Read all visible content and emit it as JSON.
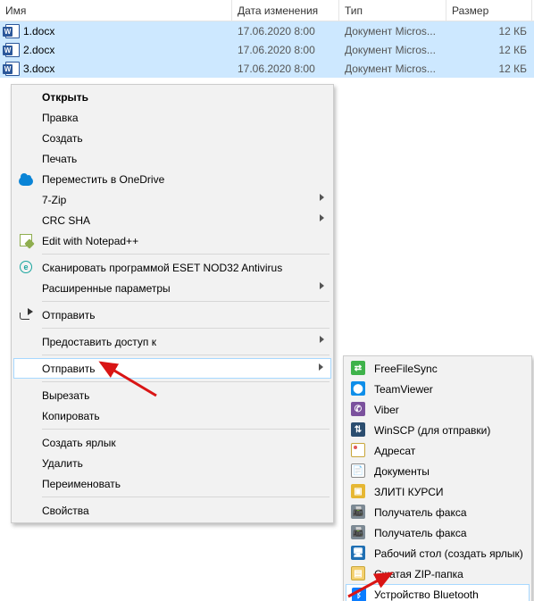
{
  "headers": {
    "name": "Имя",
    "date": "Дата изменения",
    "type": "Тип",
    "size": "Размер"
  },
  "files": [
    {
      "name": "1.docx",
      "date": "17.06.2020 8:00",
      "type": "Документ Micros...",
      "size": "12 КБ"
    },
    {
      "name": "2.docx",
      "date": "17.06.2020 8:00",
      "type": "Документ Micros...",
      "size": "12 КБ"
    },
    {
      "name": "3.docx",
      "date": "17.06.2020 8:00",
      "type": "Документ Micros...",
      "size": "12 КБ"
    }
  ],
  "menu": {
    "open": "Открыть",
    "edit": "Правка",
    "create": "Создать",
    "print": "Печать",
    "onedrive": "Переместить в OneDrive",
    "sevenzip": "7-Zip",
    "crcsha": "CRC SHA",
    "notepadpp": "Edit with Notepad++",
    "eset": "Сканировать программой ESET NOD32 Antivirus",
    "advopts": "Расширенные параметры",
    "share": "Отправить",
    "giveaccess": "Предоставить доступ к",
    "sendto": "Отправить",
    "cut": "Вырезать",
    "copy": "Копировать",
    "shortcut": "Создать ярлык",
    "delete": "Удалить",
    "rename": "Переименовать",
    "properties": "Свойства"
  },
  "sendto": {
    "freefilesync": "FreeFileSync",
    "teamviewer": "TeamViewer",
    "viber": "Viber",
    "winscp": "WinSCP (для отправки)",
    "addressee": "Адресат",
    "documents": "Документы",
    "zliti": "ЗЛИТІ КУРСИ",
    "fax1": "Получатель факса",
    "fax2": "Получатель факса",
    "desktop": "Рабочий стол (создать ярлык)",
    "zip": "Сжатая ZIP-папка",
    "bluetooth": "Устройство Bluetooth"
  }
}
